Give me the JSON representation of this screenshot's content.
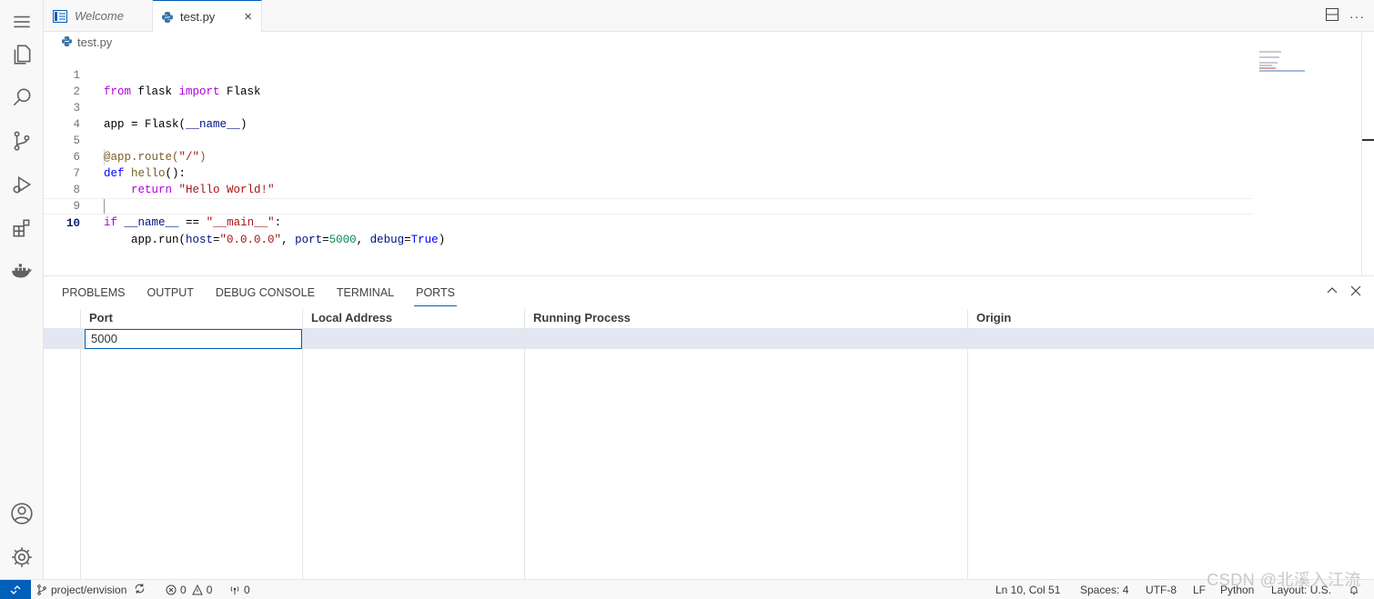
{
  "tabs": [
    {
      "label": "Welcome",
      "icon": "vscode-welcome-icon"
    },
    {
      "label": "test.py",
      "icon": "python-icon",
      "close": "×"
    }
  ],
  "breadcrumb": {
    "file": "test.py"
  },
  "editor": {
    "lines": [
      {
        "n": "1"
      },
      {
        "n": "2"
      },
      {
        "n": "3"
      },
      {
        "n": "4"
      },
      {
        "n": "5"
      },
      {
        "n": "6"
      },
      {
        "n": "7"
      },
      {
        "n": "8"
      },
      {
        "n": "9"
      },
      {
        "n": "10"
      }
    ],
    "code": {
      "l1": [
        "from",
        " flask ",
        "import",
        " Flask"
      ],
      "l3": [
        "app = Flask(",
        "__name__",
        ")"
      ],
      "l5": [
        "@app.route(",
        "\"/\"",
        ")"
      ],
      "l6": [
        "def",
        " ",
        "hello",
        "():"
      ],
      "l7": [
        "    ",
        "return",
        " ",
        "\"Hello World!\""
      ],
      "l9": [
        "if",
        " ",
        "__name__",
        " == ",
        "\"__main__\"",
        ":"
      ],
      "l10": [
        "    app.run(",
        "host",
        "=",
        "\"0.0.0.0\"",
        ", ",
        "port",
        "=",
        "5000",
        ", ",
        "debug",
        "=",
        "True",
        ")"
      ]
    }
  },
  "panel": {
    "tabs": [
      "PROBLEMS",
      "OUTPUT",
      "DEBUG CONSOLE",
      "TERMINAL",
      "PORTS"
    ],
    "active_tab": "PORTS",
    "ports": {
      "headers": [
        "Port",
        "Local Address",
        "Running Process",
        "Origin"
      ],
      "input_value": "5000"
    }
  },
  "status": {
    "branch": "project/envision",
    "errors": "0",
    "warnings": "0",
    "ports": "0",
    "position": "Ln 10, Col 51",
    "spaces": "Spaces: 4",
    "encoding": "UTF-8",
    "eol": "LF",
    "language": "Python",
    "layout": "Layout: U.S."
  },
  "watermark": "CSDN @北溪入江流",
  "colors": {
    "accent": "#005fb8",
    "keyword": "#af00db",
    "string": "#a31515",
    "number": "#098658"
  }
}
